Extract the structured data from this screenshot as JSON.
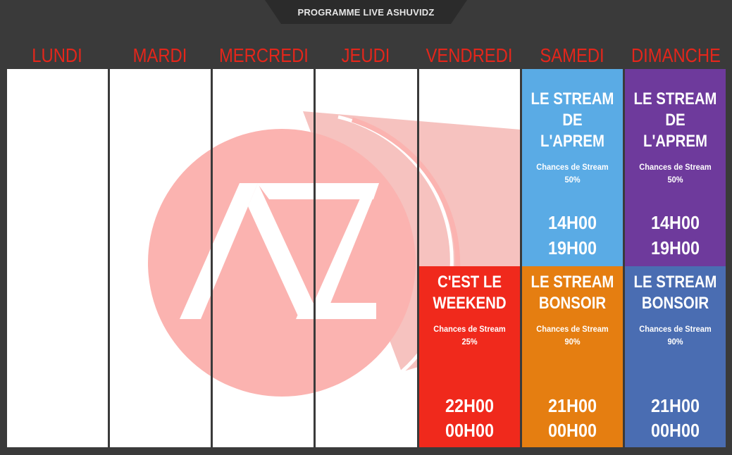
{
  "header": {
    "title": "PROGRAMME LIVE ASHUVIDZ"
  },
  "days": [
    "LUNDI",
    "MARDI",
    "MERCREDI",
    "JEUDI",
    "VENDREDI",
    "SAMEDI",
    "DIMANCHE"
  ],
  "colors": {
    "background": "#3a3a3a",
    "day_label": "#e4261b",
    "blue": "#5aabe5",
    "purple": "#6e3a9c",
    "red": "#f0291c",
    "orange": "#e57e11",
    "darkblue": "#4a6db2",
    "logo": "#fbb3b0"
  },
  "logo": {
    "letters": "AZ"
  },
  "blocks": [
    {
      "day": "SAMEDI",
      "title_line1": "LE STREAM",
      "title_line2": "DE L'APREM",
      "chance_label": "Chances de Stream",
      "chance_pct": "50%",
      "time_start": "14H00",
      "time_end": "19H00"
    },
    {
      "day": "DIMANCHE",
      "title_line1": "LE STREAM",
      "title_line2": "DE L'APREM",
      "chance_label": "Chances de Stream",
      "chance_pct": "50%",
      "time_start": "14H00",
      "time_end": "19H00"
    },
    {
      "day": "VENDREDI",
      "title_line1": "C'EST LE",
      "title_line2": "WEEKEND",
      "chance_label": "Chances de Stream",
      "chance_pct": "25%",
      "time_start": "22H00",
      "time_end": "00H00"
    },
    {
      "day": "SAMEDI",
      "title_line1": "LE STREAM",
      "title_line2": "BONSOIR",
      "chance_label": "Chances de Stream",
      "chance_pct": "90%",
      "time_start": "21H00",
      "time_end": "00H00"
    },
    {
      "day": "DIMANCHE",
      "title_line1": "LE STREAM",
      "title_line2": "BONSOIR",
      "chance_label": "Chances de Stream",
      "chance_pct": "90%",
      "time_start": "21H00",
      "time_end": "00H00"
    }
  ]
}
